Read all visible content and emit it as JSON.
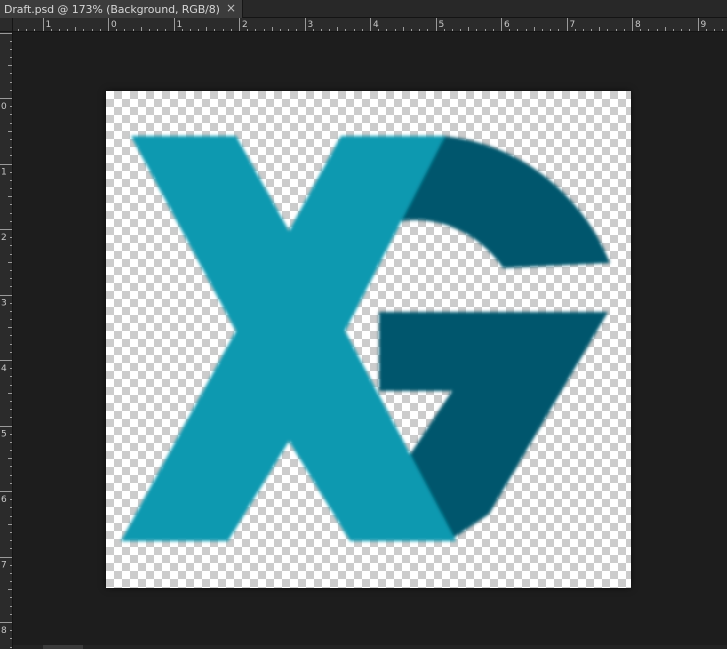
{
  "document": {
    "tab_title": "Draft.psd @ 173% (Background, RGB/8)",
    "close_glyph": "×",
    "zoom": "173%",
    "layer": "Background",
    "mode": "RGB/8"
  },
  "rulers": {
    "horizontal_labels": [
      "1",
      "0",
      "1",
      "2",
      "3",
      "4",
      "5",
      "6",
      "7",
      "8",
      "9"
    ],
    "vertical_labels": [
      "0",
      "1",
      "2",
      "3",
      "4",
      "5",
      "6",
      "7",
      "8"
    ]
  },
  "artwork": {
    "letters": "XG",
    "colors": {
      "x_teal": "#0899b0",
      "g_dark": "#02566d",
      "workspace": "#1d1d1d",
      "checker_light": "#ffffff",
      "checker_dark": "#cccccc"
    }
  }
}
